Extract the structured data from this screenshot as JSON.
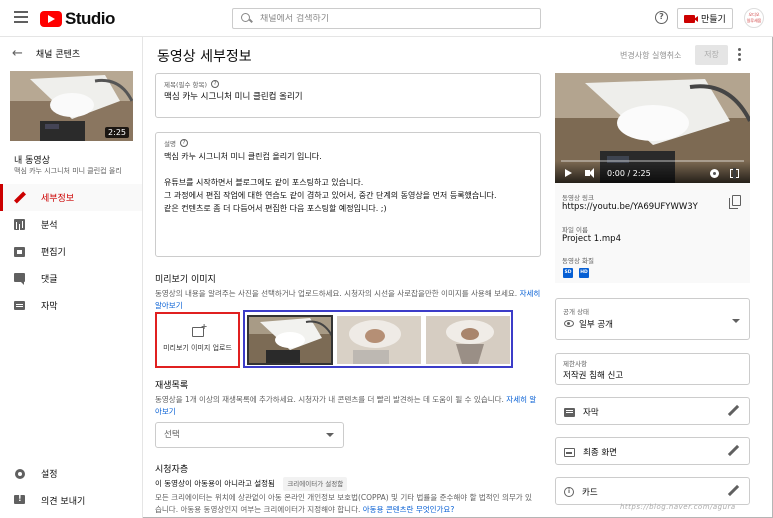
{
  "topbar": {
    "logo_text": "Studio",
    "search_placeholder": "채널에서 검색하기",
    "create_label": "만들기",
    "avatar_label": "오디오\n일루세움"
  },
  "sidebar": {
    "back_label": "채널 콘텐츠",
    "thumb_duration": "2:25",
    "my_video": "내 동영상",
    "video_title": "맥심 카누 시그니처 미니 클린컵 올리",
    "nav": [
      {
        "label": "세부정보",
        "icon": "pencil-icon"
      },
      {
        "label": "분석",
        "icon": "analytics-icon"
      },
      {
        "label": "편집기",
        "icon": "editor-icon"
      },
      {
        "label": "댓글",
        "icon": "comments-icon"
      },
      {
        "label": "자막",
        "icon": "subtitles-icon"
      }
    ],
    "bottom": [
      {
        "label": "설정",
        "icon": "gear-icon"
      },
      {
        "label": "의견 보내기",
        "icon": "feedback-icon"
      }
    ]
  },
  "main": {
    "page_title": "동영상 세부정보",
    "undo_label": "변경사항 실행취소",
    "save_label": "저장",
    "title_field": {
      "label": "제목(필수 항목)",
      "value": "맥심 카누 시그니처 미니 클린컵 올리기"
    },
    "description_field": {
      "label": "설명",
      "value": "맥심 카누 시그니처 미니 클린컵 올리기 입니다.\n\n유튜브를 시작하면서 블로그에도 같이 포스팅하고 있습니다.\n그 과정에서 편집 작업에 대한 연습도 같이 겸하고 있어서, 중간 단계의 동영상을 먼저 등록했습니다.\n같은 컨텐츠로 좀 더 다듬어서 편집한 다음 포스팅할 예정입니다. ;)"
    },
    "thumbnail": {
      "title": "미리보기 이미지",
      "desc": "동영상의 내용을 알려주는 사진을 선택하거나 업로드하세요. 시청자의 시선을 사로잡을만한 이미지를 사용해 보세요.",
      "link": "자세히 알아보기",
      "upload_label": "미리보기 이미지 업로드"
    },
    "playlist": {
      "title": "재생목록",
      "desc": "동영상을 1개 이상의 재생목록에 추가하세요. 시청자가 내 콘텐츠를 더 빨리 발견하는 데 도움이 될 수 있습니다.",
      "link": "자세히 알아보기",
      "select_value": "선택"
    },
    "audience": {
      "title": "시청자층",
      "status": "이 동영상이 아동용이 아니라고 설정됨",
      "chip": "크리에이터가 설정함",
      "desc1": "모든 크리에이터는 위치에 상관없이 아동 온라인 개인정보 보호법(COPPA) 및 기타 법률을 준수해야 할 법적인 의무가 있",
      "desc2": "습니다. 아동용 동영상인지 여부는 크리에이터가 지정해야 합니다.",
      "link": "아동용 콘텐츠란 무엇인가요?"
    }
  },
  "right": {
    "player_time": "0:00 / 2:25",
    "link_label": "동영상 링크",
    "link_value": "https://youtu.be/YA69UFYWW3Y",
    "filename_label": "파일 이름",
    "filename_value": "Project 1.mp4",
    "quality_label": "동영상 화질",
    "quality_badges": [
      "SD",
      "HD"
    ],
    "visibility_label": "공개 상태",
    "visibility_value": "일부 공개",
    "restrictions_label": "제한사항",
    "restrictions_value": "저작권 침해 신고",
    "subtitles_label": "자막",
    "endscreen_label": "최종 화면",
    "cards_label": "카드"
  },
  "watermark": "https://blog.naver.com/agura"
}
